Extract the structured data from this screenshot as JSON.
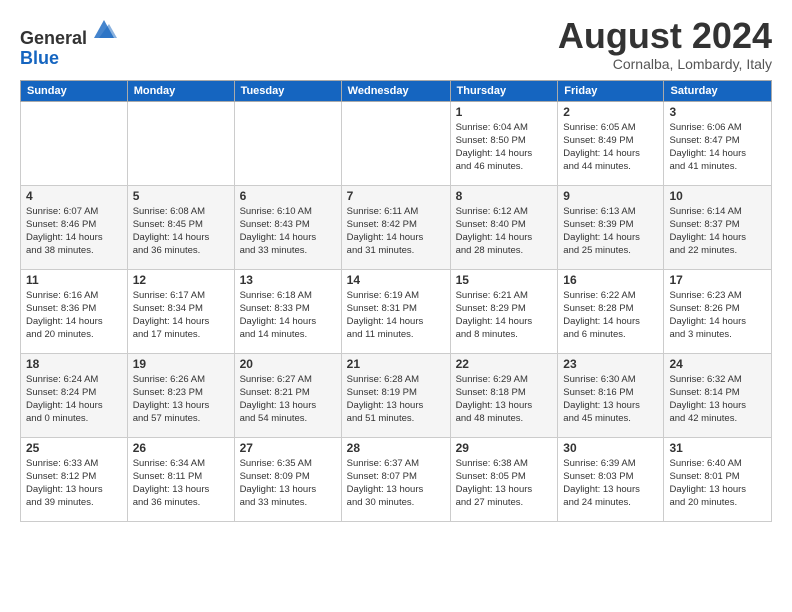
{
  "header": {
    "logo_line1": "General",
    "logo_line2": "Blue",
    "month_title": "August 2024",
    "subtitle": "Cornalba, Lombardy, Italy"
  },
  "weekdays": [
    "Sunday",
    "Monday",
    "Tuesday",
    "Wednesday",
    "Thursday",
    "Friday",
    "Saturday"
  ],
  "weeks": [
    [
      {
        "day": "",
        "info": ""
      },
      {
        "day": "",
        "info": ""
      },
      {
        "day": "",
        "info": ""
      },
      {
        "day": "",
        "info": ""
      },
      {
        "day": "1",
        "info": "Sunrise: 6:04 AM\nSunset: 8:50 PM\nDaylight: 14 hours\nand 46 minutes."
      },
      {
        "day": "2",
        "info": "Sunrise: 6:05 AM\nSunset: 8:49 PM\nDaylight: 14 hours\nand 44 minutes."
      },
      {
        "day": "3",
        "info": "Sunrise: 6:06 AM\nSunset: 8:47 PM\nDaylight: 14 hours\nand 41 minutes."
      }
    ],
    [
      {
        "day": "4",
        "info": "Sunrise: 6:07 AM\nSunset: 8:46 PM\nDaylight: 14 hours\nand 38 minutes."
      },
      {
        "day": "5",
        "info": "Sunrise: 6:08 AM\nSunset: 8:45 PM\nDaylight: 14 hours\nand 36 minutes."
      },
      {
        "day": "6",
        "info": "Sunrise: 6:10 AM\nSunset: 8:43 PM\nDaylight: 14 hours\nand 33 minutes."
      },
      {
        "day": "7",
        "info": "Sunrise: 6:11 AM\nSunset: 8:42 PM\nDaylight: 14 hours\nand 31 minutes."
      },
      {
        "day": "8",
        "info": "Sunrise: 6:12 AM\nSunset: 8:40 PM\nDaylight: 14 hours\nand 28 minutes."
      },
      {
        "day": "9",
        "info": "Sunrise: 6:13 AM\nSunset: 8:39 PM\nDaylight: 14 hours\nand 25 minutes."
      },
      {
        "day": "10",
        "info": "Sunrise: 6:14 AM\nSunset: 8:37 PM\nDaylight: 14 hours\nand 22 minutes."
      }
    ],
    [
      {
        "day": "11",
        "info": "Sunrise: 6:16 AM\nSunset: 8:36 PM\nDaylight: 14 hours\nand 20 minutes."
      },
      {
        "day": "12",
        "info": "Sunrise: 6:17 AM\nSunset: 8:34 PM\nDaylight: 14 hours\nand 17 minutes."
      },
      {
        "day": "13",
        "info": "Sunrise: 6:18 AM\nSunset: 8:33 PM\nDaylight: 14 hours\nand 14 minutes."
      },
      {
        "day": "14",
        "info": "Sunrise: 6:19 AM\nSunset: 8:31 PM\nDaylight: 14 hours\nand 11 minutes."
      },
      {
        "day": "15",
        "info": "Sunrise: 6:21 AM\nSunset: 8:29 PM\nDaylight: 14 hours\nand 8 minutes."
      },
      {
        "day": "16",
        "info": "Sunrise: 6:22 AM\nSunset: 8:28 PM\nDaylight: 14 hours\nand 6 minutes."
      },
      {
        "day": "17",
        "info": "Sunrise: 6:23 AM\nSunset: 8:26 PM\nDaylight: 14 hours\nand 3 minutes."
      }
    ],
    [
      {
        "day": "18",
        "info": "Sunrise: 6:24 AM\nSunset: 8:24 PM\nDaylight: 14 hours\nand 0 minutes."
      },
      {
        "day": "19",
        "info": "Sunrise: 6:26 AM\nSunset: 8:23 PM\nDaylight: 13 hours\nand 57 minutes."
      },
      {
        "day": "20",
        "info": "Sunrise: 6:27 AM\nSunset: 8:21 PM\nDaylight: 13 hours\nand 54 minutes."
      },
      {
        "day": "21",
        "info": "Sunrise: 6:28 AM\nSunset: 8:19 PM\nDaylight: 13 hours\nand 51 minutes."
      },
      {
        "day": "22",
        "info": "Sunrise: 6:29 AM\nSunset: 8:18 PM\nDaylight: 13 hours\nand 48 minutes."
      },
      {
        "day": "23",
        "info": "Sunrise: 6:30 AM\nSunset: 8:16 PM\nDaylight: 13 hours\nand 45 minutes."
      },
      {
        "day": "24",
        "info": "Sunrise: 6:32 AM\nSunset: 8:14 PM\nDaylight: 13 hours\nand 42 minutes."
      }
    ],
    [
      {
        "day": "25",
        "info": "Sunrise: 6:33 AM\nSunset: 8:12 PM\nDaylight: 13 hours\nand 39 minutes."
      },
      {
        "day": "26",
        "info": "Sunrise: 6:34 AM\nSunset: 8:11 PM\nDaylight: 13 hours\nand 36 minutes."
      },
      {
        "day": "27",
        "info": "Sunrise: 6:35 AM\nSunset: 8:09 PM\nDaylight: 13 hours\nand 33 minutes."
      },
      {
        "day": "28",
        "info": "Sunrise: 6:37 AM\nSunset: 8:07 PM\nDaylight: 13 hours\nand 30 minutes."
      },
      {
        "day": "29",
        "info": "Sunrise: 6:38 AM\nSunset: 8:05 PM\nDaylight: 13 hours\nand 27 minutes."
      },
      {
        "day": "30",
        "info": "Sunrise: 6:39 AM\nSunset: 8:03 PM\nDaylight: 13 hours\nand 24 minutes."
      },
      {
        "day": "31",
        "info": "Sunrise: 6:40 AM\nSunset: 8:01 PM\nDaylight: 13 hours\nand 20 minutes."
      }
    ]
  ]
}
